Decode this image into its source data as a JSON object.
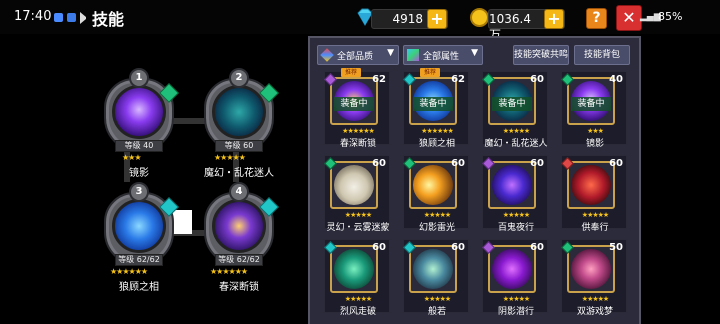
{
  "status": {
    "time": "17:40",
    "battery": "85%",
    "signal": "▂▄▆"
  },
  "header": {
    "title": "技能",
    "diamonds": "4918",
    "coins": "1036.4万",
    "help_label": "?",
    "close_label": "✕"
  },
  "colors": {
    "accent": "#f4b716",
    "panel": "#2b2b3b",
    "star": "#f6c31a"
  },
  "slots": [
    {
      "num": "1",
      "level": "等级 40",
      "stars": "★★★",
      "name": "镜影",
      "gem": "green-gem-icon"
    },
    {
      "num": "2",
      "level": "等级 60",
      "stars": "★★★★★",
      "name": "魔幻・乱花迷人",
      "gem": "green-gem-icon"
    },
    {
      "num": "3",
      "level": "等级 62/62",
      "stars": "★★★★★★",
      "name": "狼顾之相",
      "gem": "cyan-gem-icon"
    },
    {
      "num": "4",
      "level": "等级 62/62",
      "stars": "★★★★★★",
      "name": "春深断锁",
      "gem": "cyan-gem-icon"
    }
  ],
  "filters": {
    "quality": "全部品质",
    "attribute": "全部属性",
    "share_btn": "技能突破共鸣",
    "bag_btn": "技能背包"
  },
  "skills": [
    {
      "name": "春深断锁",
      "level": "62",
      "stars": "★★★★★★",
      "equipped": "装备中",
      "tag": "推荐"
    },
    {
      "name": "狼顾之相",
      "level": "62",
      "stars": "★★★★★★",
      "equipped": "装备中",
      "tag": "推荐"
    },
    {
      "name": "魔幻・乱花迷人",
      "level": "60",
      "stars": "★★★★★",
      "equipped": "装备中",
      "tag": ""
    },
    {
      "name": "镜影",
      "level": "40",
      "stars": "★★★",
      "equipped": "装备中",
      "tag": ""
    },
    {
      "name": "灵幻・云雾迷蒙",
      "level": "60",
      "stars": "★★★★★",
      "equipped": "",
      "tag": ""
    },
    {
      "name": "幻影雷光",
      "level": "60",
      "stars": "★★★★★",
      "equipped": "",
      "tag": ""
    },
    {
      "name": "百鬼夜行",
      "level": "60",
      "stars": "★★★★★",
      "equipped": "",
      "tag": ""
    },
    {
      "name": "供奉行",
      "level": "60",
      "stars": "★★★★★",
      "equipped": "",
      "tag": ""
    },
    {
      "name": "烈风走破",
      "level": "60",
      "stars": "★★★★★",
      "equipped": "",
      "tag": ""
    },
    {
      "name": "般若",
      "level": "60",
      "stars": "★★★★★",
      "equipped": "",
      "tag": ""
    },
    {
      "name": "阴影潜行",
      "level": "60",
      "stars": "★★★★★",
      "equipped": "",
      "tag": ""
    },
    {
      "name": "双游戏梦",
      "level": "50",
      "stars": "★★★★★",
      "equipped": "",
      "tag": ""
    }
  ]
}
